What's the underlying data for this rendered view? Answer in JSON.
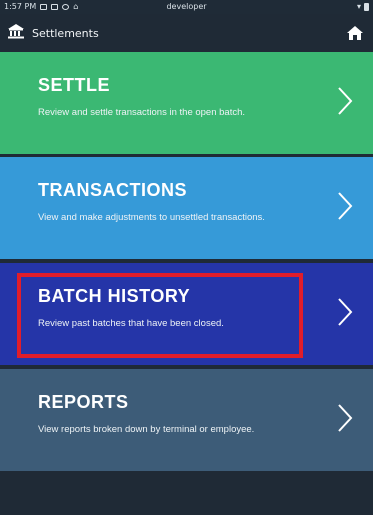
{
  "status_bar": {
    "time": "1:57 PM",
    "label": "developer"
  },
  "header": {
    "title": "Settlements",
    "icon": "bank-icon",
    "home_icon": "home-icon"
  },
  "tiles": [
    {
      "heading": "SETTLE",
      "description": "Review and settle transactions in the open batch.",
      "color": "#3bb873"
    },
    {
      "heading": "TRANSACTIONS",
      "description": "View and make adjustments to unsettled transactions.",
      "color": "#369ad8"
    },
    {
      "heading": "BATCH HISTORY",
      "description": "Review past batches that have been closed.",
      "color": "#2535a8"
    },
    {
      "heading": "REPORTS",
      "description": "View reports broken down by terminal or employee.",
      "color": "#3d5c78"
    }
  ],
  "selection_highlight_color": "#e11d2a"
}
